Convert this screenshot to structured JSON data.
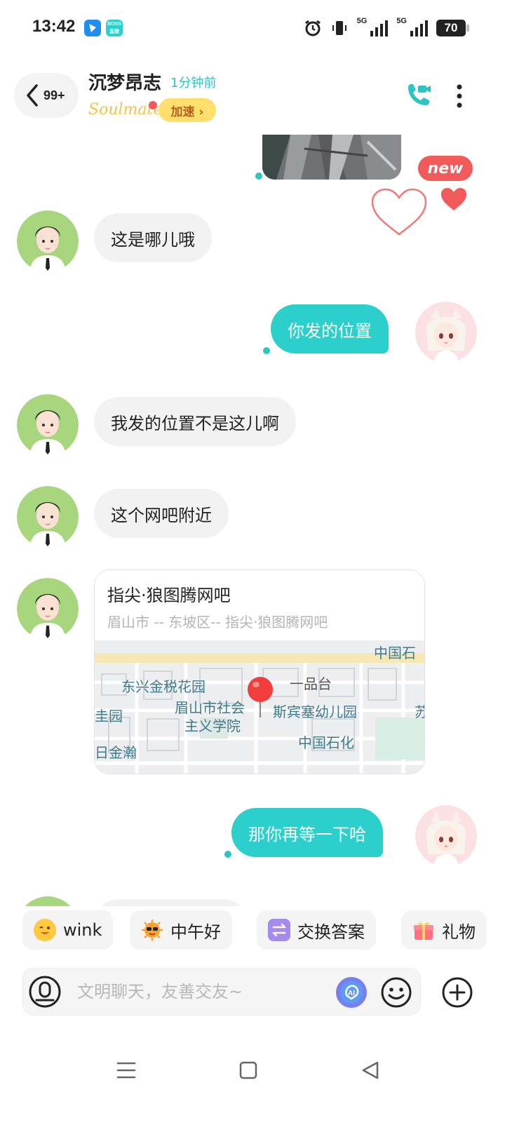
{
  "status_bar": {
    "time": "13:42",
    "app_icon_1": "lark-icon",
    "app_icon_2_label": "BOSS",
    "signal_1": "5G",
    "signal_2": "5G",
    "battery": "70"
  },
  "header": {
    "back_count": "99+",
    "contact_name": "沉梦昂志",
    "last_seen": "1分钟前",
    "soulmate_label": "Soulmate",
    "boost_label": "加速 ›"
  },
  "image_badge": "new",
  "messages": [
    {
      "direction": "in",
      "text": "这是哪儿哦"
    },
    {
      "direction": "out",
      "text": "你发的位置"
    },
    {
      "direction": "in",
      "text": "我发的位置不是这儿啊"
    },
    {
      "direction": "in",
      "text": "这个网吧附近"
    },
    {
      "direction": "out",
      "text": "那你再等一下哈"
    }
  ],
  "location_card": {
    "title": "指尖·狼图腾网吧",
    "address": "眉山市 -- 东坡区-- 指尖·狼图腾网吧",
    "map_labels": [
      "中国石",
      "东兴金税花园",
      "一品台",
      "眉山市社会",
      "主义学院",
      "斯宾塞幼儿园",
      "圭园",
      "中国石化",
      "日金瀚",
      "苏"
    ]
  },
  "quick_replies": [
    {
      "label": "wink",
      "icon": "wink-emoji-icon"
    },
    {
      "label": "中午好",
      "icon": "sun-sunglasses-icon"
    },
    {
      "label": "交换答案",
      "icon": "swap-icon"
    },
    {
      "label": "礼物",
      "icon": "gift-icon"
    }
  ],
  "input": {
    "placeholder": "文明聊天，友善交友~",
    "value": ""
  },
  "colors": {
    "accent": "#2bcfcb",
    "incoming_bubble": "#f2f2f2",
    "boost": "#ffdf6c",
    "heart": "#f25a5a"
  }
}
